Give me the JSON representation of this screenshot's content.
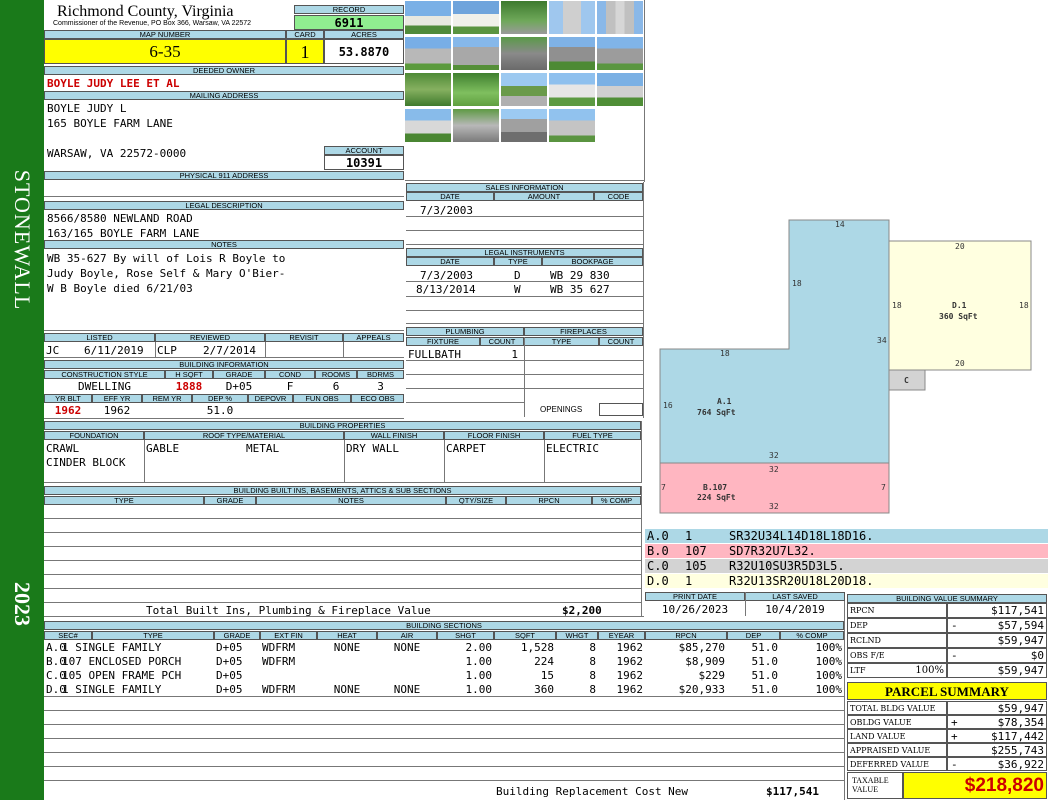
{
  "side": {
    "district": "STONEWALL",
    "year": "2023",
    "color": "#1a7a1a"
  },
  "header": {
    "county": "Richmond County, Virginia",
    "commissioner": "Commissioner of the Revenue, PO Box 366, Warsaw, VA 22572",
    "record_label": "RECORD",
    "record": "6911",
    "map_label": "MAP NUMBER",
    "map": "6-35",
    "card_label": "CARD",
    "card": "1",
    "acres_label": "ACRES",
    "acres": "53.8870"
  },
  "owner": {
    "deeded_label": "DEEDED OWNER",
    "deeded": "BOYLE JUDY LEE ET AL",
    "mailing_label": "MAILING ADDRESS",
    "mailing": [
      "BOYLE JUDY L",
      "165 BOYLE FARM LANE",
      "",
      "WARSAW, VA 22572-0000"
    ],
    "account_label": "ACCOUNT",
    "account": "10391",
    "physical_label": "PHYSICAL 911 ADDRESS",
    "physical": ""
  },
  "legal": {
    "label": "LEGAL DESCRIPTION",
    "lines": [
      "8566/8580 NEWLAND ROAD",
      "163/165 BOYLE FARM LANE"
    ]
  },
  "notes": {
    "label": "NOTES",
    "lines": [
      "WB 35-627 By will of Lois R Boyle to",
      "Judy Boyle, Rose Self & Mary O'Bier-",
      "W B Boyle died 6/21/03"
    ]
  },
  "sales": {
    "label": "SALES INFORMATION",
    "cols": [
      "DATE",
      "AMOUNT",
      "CODE"
    ],
    "rows": [
      [
        "7/3/2003",
        "",
        ""
      ]
    ]
  },
  "instruments": {
    "label": "LEGAL INSTRUMENTS",
    "cols": [
      "DATE",
      "TYPE",
      "BOOKPAGE"
    ],
    "rows": [
      [
        "7/3/2003",
        "D",
        "WB 29 830"
      ],
      [
        "8/13/2014",
        "W",
        "WB 35 627"
      ]
    ]
  },
  "review": {
    "cols": [
      "LISTED",
      "REVIEWED",
      "REVISIT",
      "APPEALS"
    ],
    "listed_by": "JC",
    "listed": "6/11/2019",
    "reviewed_by": "CLP",
    "reviewed": "2/7/2014"
  },
  "plumbing": {
    "label": "PLUMBING",
    "cols": [
      "FIXTURE",
      "COUNT"
    ],
    "rows": [
      [
        "FULLBATH",
        "1"
      ]
    ]
  },
  "fireplaces": {
    "label": "FIREPLACES",
    "cols": [
      "TYPE",
      "COUNT"
    ],
    "openings_label": "OPENINGS"
  },
  "building_info": {
    "label": "BUILDING INFORMATION",
    "cols1": [
      "CONSTRUCTION STYLE",
      "H SQFT",
      "GRADE",
      "COND",
      "ROOMS",
      "BDRMS"
    ],
    "vals1": [
      "DWELLING",
      "1888",
      "D+05",
      "F",
      "6",
      "3"
    ],
    "cols2": [
      "YR BLT",
      "EFF YR",
      "REM YR",
      "DEP %",
      "DEPOVR",
      "FUN OBS",
      "ECO OBS"
    ],
    "vals2": [
      "1962",
      "1962",
      "",
      "51.0",
      "",
      "",
      ""
    ]
  },
  "properties": {
    "label": "BUILDING PROPERTIES",
    "cols": [
      "FOUNDATION",
      "ROOF TYPE/MATERIAL",
      "WALL FINISH",
      "FLOOR FINISH",
      "FUEL TYPE"
    ],
    "foundation": [
      "CRAWL",
      "CINDER BLOCK"
    ],
    "roof_type": "GABLE",
    "roof_material": "METAL",
    "wall": "DRY WALL",
    "floor": "CARPET",
    "fuel": "ELECTRIC"
  },
  "builtins": {
    "label": "BUILDING BUILT INS, BASEMENTS, ATTICS & SUB SECTIONS",
    "cols": [
      "TYPE",
      "GRADE",
      "NOTES",
      "QTY/SIZE",
      "RPCN",
      "% COMP"
    ],
    "total_label": "Total Built Ins, Plumbing & Fireplace Value",
    "total": "$2,200"
  },
  "sections": {
    "label": "BUILDING SECTIONS",
    "cols": [
      "SEC#",
      "TYPE",
      "GRADE",
      "EXT FIN",
      "HEAT",
      "AIR",
      "SHGT",
      "SQFT",
      "WHGT",
      "EYEAR",
      "RPCN",
      "DEP",
      "% COMP"
    ],
    "rows": [
      [
        "A.0",
        "1 SINGLE FAMILY",
        "D+05",
        "WDFRM",
        "NONE",
        "NONE",
        "2.00",
        "1,528",
        "8",
        "1962",
        "$85,270",
        "51.0",
        "100%"
      ],
      [
        "B.0",
        "107 ENCLOSED PORCH",
        "D+05",
        "WDFRM",
        "",
        "",
        "1.00",
        "224",
        "8",
        "1962",
        "$8,909",
        "51.0",
        "100%"
      ],
      [
        "C.0",
        "105 OPEN FRAME PCH",
        "D+05",
        "",
        "",
        "",
        "1.00",
        "15",
        "8",
        "1962",
        "$229",
        "51.0",
        "100%"
      ],
      [
        "D.0",
        "1 SINGLE FAMILY",
        "D+05",
        "WDFRM",
        "NONE",
        "NONE",
        "1.00",
        "360",
        "8",
        "1962",
        "$20,933",
        "51.0",
        "100%"
      ]
    ],
    "replacement_label": "Building Replacement Cost New",
    "replacement": "$117,541"
  },
  "sketch": {
    "labels": {
      "a": "A.1",
      "a_area": "764 SqFt",
      "b": "B.107",
      "b_area": "224 SqFt",
      "c": "C",
      "d": "D.1",
      "d_area": "360 SqFt"
    },
    "dims": {
      "a_top": "14",
      "a_right_upper": "18",
      "a_left_step": "18",
      "a_right": "34",
      "a_left": "16",
      "a_bottom": "32",
      "b_top": "32",
      "b_bottom": "32",
      "b_left": "7",
      "b_right": "7",
      "d_top": "20",
      "d_bottom": "20",
      "d_left": "18",
      "d_right": "18"
    },
    "colors": {
      "a": "#add8e6",
      "b": "#ffb6c1",
      "c": "#d3d3d3",
      "d": "#ffffe0"
    }
  },
  "vectors": [
    {
      "sec": "A.0",
      "code": "1",
      "vec": "SR32U34L14D18L18D16.",
      "color": "#add8e6"
    },
    {
      "sec": "B.0",
      "code": "107",
      "vec": "SD7R32U7L32.",
      "color": "#ffb6c1"
    },
    {
      "sec": "C.0",
      "code": "105",
      "vec": "R32U10SU3R5D3L5.",
      "color": "#d3d3d3"
    },
    {
      "sec": "D.0",
      "code": "1",
      "vec": "R32U13SR20U18L20D18.",
      "color": "#ffffe0"
    }
  ],
  "dates": {
    "print_label": "PRINT DATE",
    "print": "10/26/2023",
    "saved_label": "LAST SAVED",
    "saved": "10/4/2019"
  },
  "value_summary": {
    "label": "BUILDING VALUE SUMMARY",
    "rows": [
      {
        "k": "RPCN",
        "op": "",
        "v": "$117,541"
      },
      {
        "k": "DEP",
        "op": "-",
        "v": "$57,594"
      },
      {
        "k": "RCLND",
        "op": "",
        "v": "$59,947"
      },
      {
        "k": "OBS F/E",
        "op": "-",
        "v": "$0"
      },
      {
        "k": "LTF",
        "pct": "100%",
        "op": "",
        "v": "$59,947"
      }
    ]
  },
  "parcel": {
    "label": "PARCEL SUMMARY",
    "rows": [
      {
        "k": "TOTAL BLDG VALUE",
        "op": "",
        "v": "$59,947"
      },
      {
        "k": "OBLDG VALUE",
        "op": "+",
        "v": "$78,354"
      },
      {
        "k": "LAND VALUE",
        "op": "+",
        "v": "$117,442"
      },
      {
        "k": "APPRAISED VALUE",
        "op": "",
        "v": "$255,743"
      },
      {
        "k": "DEFERRED VALUE",
        "op": "-",
        "v": "$36,922"
      }
    ],
    "taxable_label": "TAXABLE VALUE",
    "taxable": "$218,820",
    "accent": "#ffff00"
  },
  "photos": {
    "count": 20
  }
}
